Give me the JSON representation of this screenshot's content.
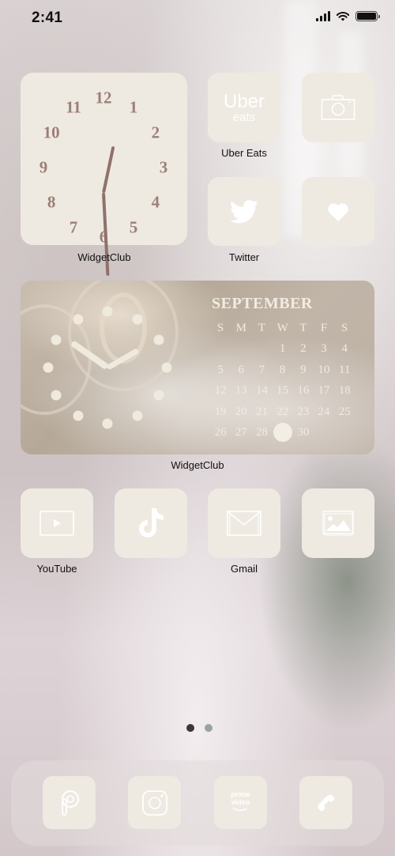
{
  "status_bar": {
    "time": "2:41",
    "signal_icon": "cellular-signal-icon",
    "wifi_icon": "wifi-icon",
    "battery_icon": "battery-full-icon"
  },
  "theme": {
    "tile_color": "#eeeae2",
    "clock_numeral_color": "#9c7f78",
    "label_color": "#111111"
  },
  "clock_widget": {
    "label": "WidgetClub",
    "numerals": [
      "12",
      "1",
      "2",
      "3",
      "4",
      "5",
      "6",
      "7",
      "8",
      "9",
      "10",
      "11"
    ],
    "time_shown": "12:30"
  },
  "apps_row1": [
    {
      "name": "Uber Eats",
      "label": "Uber Eats",
      "icon": "uber-eats-icon",
      "icon_text_1": "Uber",
      "icon_text_2": "eats"
    },
    {
      "name": "Camera",
      "label": "",
      "icon": "camera-icon"
    },
    {
      "name": "Twitter",
      "label": "Twitter",
      "icon": "twitter-bird-icon"
    },
    {
      "name": "Health",
      "label": "",
      "icon": "heart-icon"
    }
  ],
  "calendar_widget": {
    "label": "WidgetClub",
    "month": "SEPTEMBER",
    "weekdays": [
      "S",
      "M",
      "T",
      "W",
      "T",
      "F",
      "S"
    ],
    "leading_blanks": 3,
    "days_in_month": 30,
    "today": 29,
    "clock_time_shown": "10:10"
  },
  "apps_row3": [
    {
      "name": "YouTube",
      "label": "YouTube",
      "icon": "youtube-play-icon"
    },
    {
      "name": "TikTok",
      "label": "",
      "icon": "tiktok-note-icon"
    },
    {
      "name": "Gmail",
      "label": "Gmail",
      "icon": "mail-envelope-icon"
    },
    {
      "name": "Photos",
      "label": "",
      "icon": "photos-image-icon"
    }
  ],
  "page_indicator": {
    "pages": 2,
    "current": 1
  },
  "dock": [
    {
      "name": "PicsArt",
      "icon": "picsart-p-icon"
    },
    {
      "name": "Instagram",
      "icon": "instagram-camera-icon"
    },
    {
      "name": "Prime Video",
      "icon": "prime-video-icon",
      "icon_text_1": "prime",
      "icon_text_2": "video"
    },
    {
      "name": "Phone",
      "icon": "phone-handset-icon"
    }
  ]
}
